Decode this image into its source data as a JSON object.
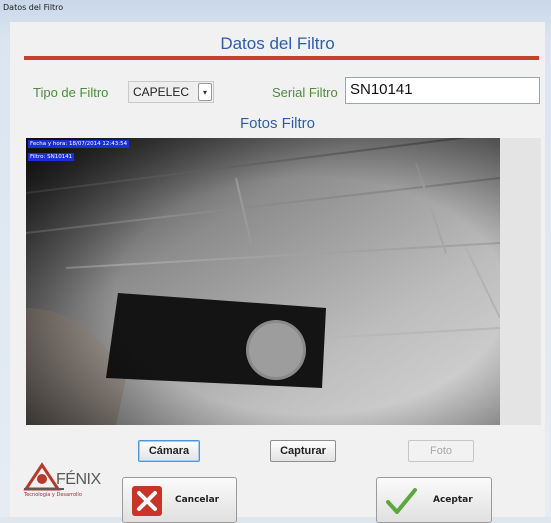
{
  "window": {
    "title": "Datos del Filtro"
  },
  "header": {
    "title": "Datos del Filtro"
  },
  "form": {
    "tipo_label": "Tipo de Filtro",
    "tipo_value": "CAPELEC",
    "serial_label": "Serial Filtro",
    "serial_value": "SN10141"
  },
  "photos": {
    "title": "Fotos Filtro",
    "overlay_datetime": "Fecha y hora: 18/07/2014 12:43:54",
    "overlay_filter": "Filtro: SN10141"
  },
  "buttons": {
    "camara": "Cámara",
    "capturar": "Capturar",
    "foto": "Foto",
    "cancelar": "Cancelar",
    "aceptar": "Aceptar"
  },
  "logo": {
    "name": "FÉNIX",
    "tagline": "Tecnología y Desarrollo"
  },
  "colors": {
    "accent_blue": "#2e5ea9",
    "label_green": "#4f8a3f",
    "divider_red": "#c5412d"
  },
  "icons": [
    "dropdown-arrow-icon",
    "cancel-x-icon",
    "accept-check-icon",
    "fenix-logo-icon"
  ]
}
